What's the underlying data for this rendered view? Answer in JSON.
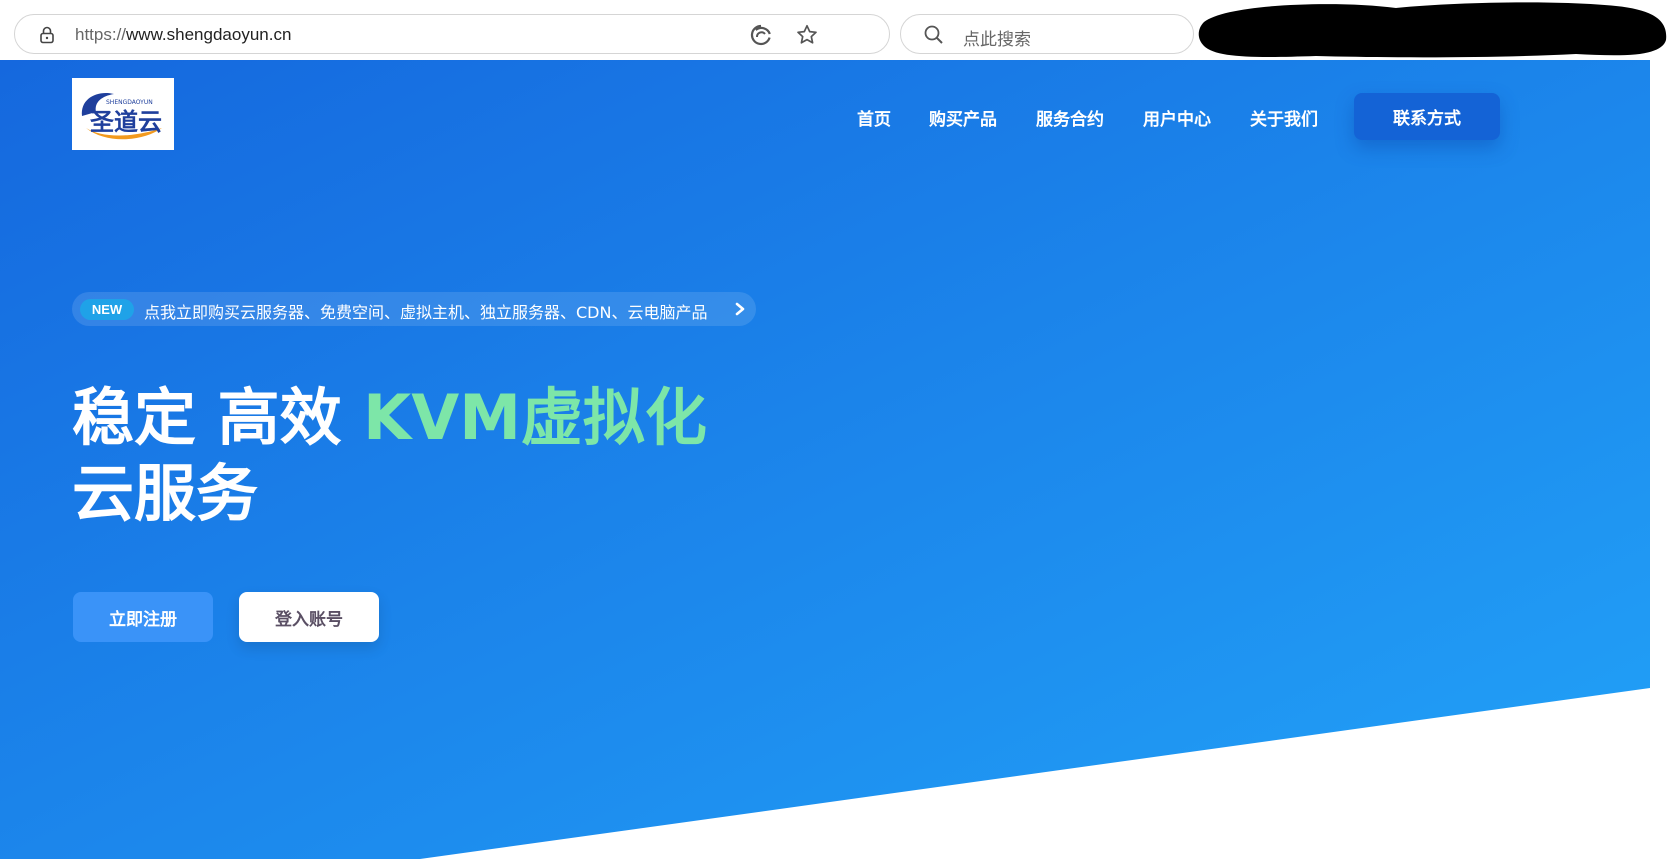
{
  "browser": {
    "url_scheme": "https://",
    "url_host": "www.shengdaoyun.cn",
    "search_placeholder": "点此搜索"
  },
  "site": {
    "nav": [
      {
        "label": "首页"
      },
      {
        "label": "购买产品"
      },
      {
        "label": "服务合约"
      },
      {
        "label": "用户中心"
      },
      {
        "label": "关于我们"
      }
    ],
    "nav_cta": "联系方式",
    "logo_text": "圣道云",
    "logo_subtext": "SHENGDAOYUN"
  },
  "promo": {
    "badge": "NEW",
    "text": "点我立即购买云服务器、免费空间、虚拟主机、独立服务器、CDN、云电脑产品"
  },
  "headline": {
    "part1": "稳定 高效 ",
    "accent": "KVM虚拟化",
    "part2": " 云服务"
  },
  "buttons": {
    "register": "立即注册",
    "login": "登入账号"
  },
  "colors": {
    "hero_gradient_start": "#1568de",
    "hero_gradient_end": "#22a3f8",
    "accent_green": "#7de6a8",
    "cta_blue": "#1463d6"
  }
}
